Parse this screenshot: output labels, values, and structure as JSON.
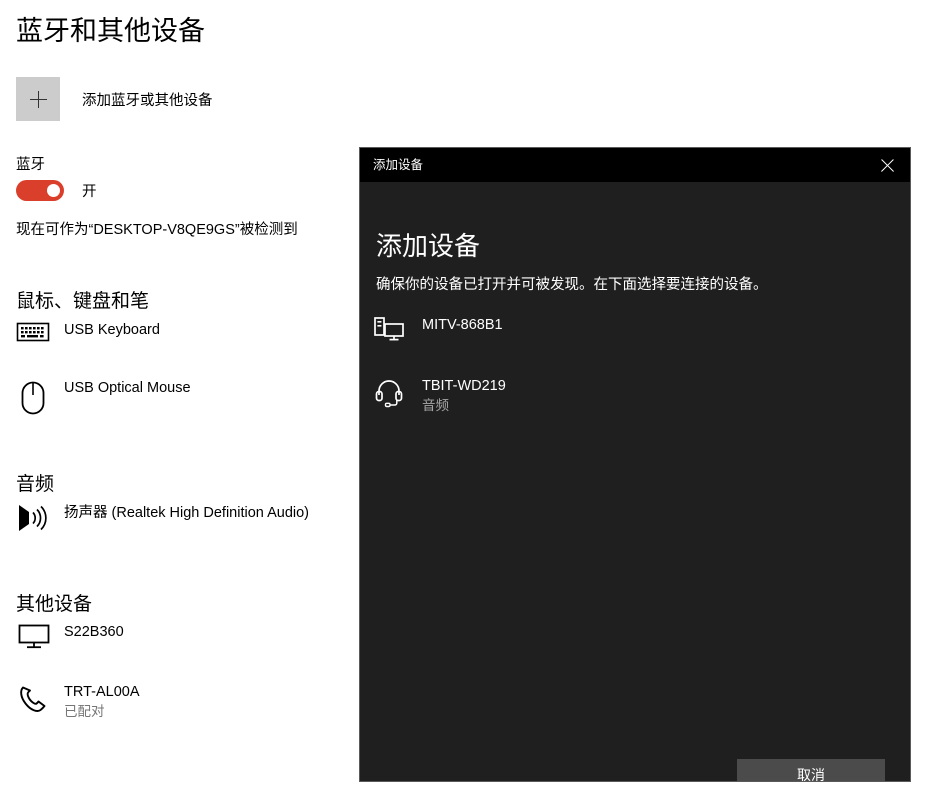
{
  "settings": {
    "page_title": "蓝牙和其他设备",
    "add_device": {
      "icon": "plus-icon",
      "label": "添加蓝牙或其他设备"
    },
    "bluetooth": {
      "label": "蓝牙",
      "toggle_state": "开",
      "toggle_on": true,
      "toggle_color": "#d93f2b",
      "discoverable_text": "现在可作为“DESKTOP-V8QE9GS”被检测到"
    },
    "sections": [
      {
        "heading": "鼠标、键盘和笔",
        "devices": [
          {
            "icon": "keyboard-icon",
            "name": "USB Keyboard",
            "sub": ""
          },
          {
            "icon": "mouse-icon",
            "name": "USB Optical Mouse",
            "sub": ""
          }
        ]
      },
      {
        "heading": "音频",
        "devices": [
          {
            "icon": "speaker-icon",
            "name": "扬声器 (Realtek High Definition Audio)",
            "sub": ""
          }
        ]
      },
      {
        "heading": "其他设备",
        "devices": [
          {
            "icon": "monitor-icon",
            "name": "S22B360",
            "sub": ""
          },
          {
            "icon": "phone-icon",
            "name": "TRT-AL00A",
            "sub": "已配对"
          }
        ]
      }
    ]
  },
  "dialog": {
    "titlebar_text": "添加设备",
    "close_icon": "close-icon",
    "heading": "添加设备",
    "subtitle": "确保你的设备已打开并可被发现。在下面选择要连接的设备。",
    "devices": [
      {
        "icon": "desktop-pc-icon",
        "name": "MITV-868B1",
        "sub": ""
      },
      {
        "icon": "headset-icon",
        "name": "TBIT-WD219",
        "sub": "音频"
      }
    ],
    "cancel_label": "取消",
    "background": "#1f1f1f",
    "titlebar_background": "#000000",
    "button_background": "#4b4b4b"
  }
}
